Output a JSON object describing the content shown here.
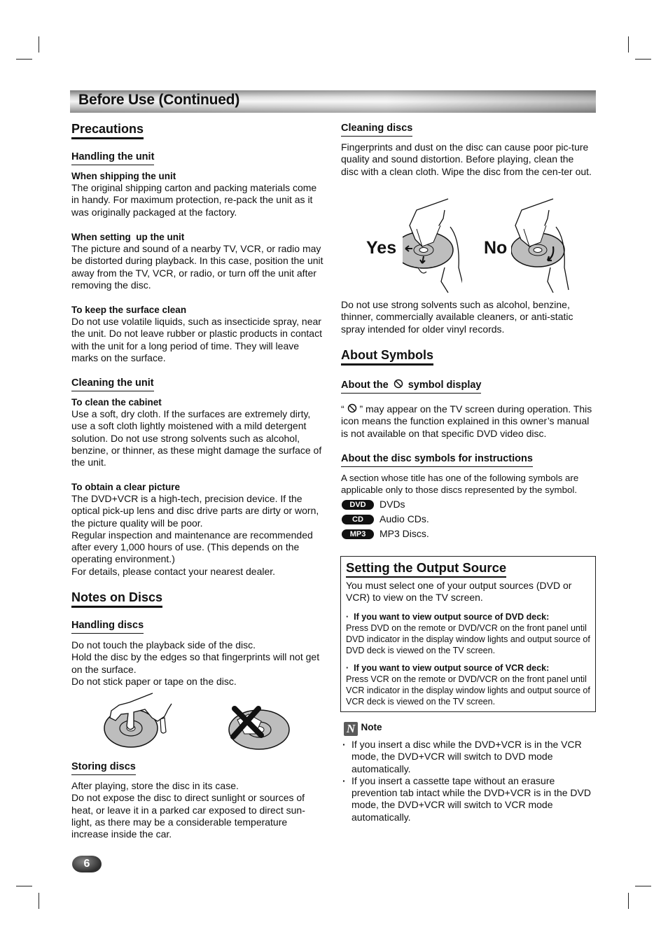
{
  "header": {
    "title": "Before Use (Continued)"
  },
  "left": {
    "precautions": {
      "title": "Precautions",
      "handling_unit": {
        "title": "Handling the unit",
        "items": [
          {
            "heading": "When shipping the unit",
            "text": "The original shipping carton and packing materials come in handy. For maximum protection, re-pack the unit as it was originally packaged at the factory."
          },
          {
            "heading": "When setting  up the unit",
            "text": "The picture and sound of a nearby TV, VCR, or radio may be distorted during playback. In this case, position the unit away from the TV, VCR, or radio, or turn off the unit after removing the disc."
          },
          {
            "heading": "To keep the surface clean",
            "text": "Do not use volatile liquids, such as insecticide spray, near the unit. Do not leave rubber or plastic products in contact with the unit for a long period of time. They will leave marks on the surface."
          }
        ]
      },
      "cleaning_unit": {
        "title": "Cleaning the unit",
        "items": [
          {
            "heading": "To clean the cabinet",
            "text": "Use a soft, dry cloth. If the surfaces are extremely dirty, use a soft cloth lightly moistened with a mild detergent solution. Do not use strong solvents such as alcohol, benzine, or thinner, as these might damage the surface of the unit."
          },
          {
            "heading": "To obtain a clear picture",
            "text": "The DVD+VCR is a high-tech, precision device. If the optical pick-up lens and disc drive parts are dirty or worn, the picture quality will be poor.",
            "text2": "Regular inspection and maintenance are recommended after every 1,000 hours of use. (This depends on the operating environment.)",
            "text3": "For details, please contact your nearest dealer."
          }
        ]
      }
    },
    "notes_on_discs": {
      "title": "Notes on Discs",
      "handling_discs": {
        "title": "Handling discs",
        "lines": [
          "Do not touch the playback side of the disc.",
          "Hold the disc by the edges so that fingerprints will not get on the surface.",
          "Do not stick paper or tape on the disc."
        ]
      },
      "storing_discs": {
        "title": "Storing discs",
        "lines": [
          "After playing, store the disc in its case.",
          "Do not expose the disc to direct sunlight or sources of heat, or leave it in a parked car exposed to direct sun-light, as there may be a considerable temperature increase inside the car."
        ]
      }
    }
  },
  "right": {
    "cleaning_discs": {
      "title": "Cleaning discs",
      "text": "Fingerprints and dust on the disc can cause poor pic-ture quality and sound distortion. Before playing, clean the disc with a clean cloth. Wipe the disc from the cen-ter out.",
      "yes_label": "Yes",
      "no_label": "No",
      "warning": "Do not use strong solvents such as alcohol, benzine, thinner, commercially available cleaners, or anti-static spray intended for older vinyl records."
    },
    "about_symbols": {
      "title": "About Symbols",
      "symbol_display": {
        "title_before": "About the",
        "title_after": "symbol display",
        "text_open": "“",
        "text_after": "” may appear on the TV screen during operation. This icon means the function explained in this owner’s manual is not available on that specific DVD video disc."
      },
      "disc_symbols": {
        "title": "About the disc symbols for instructions",
        "text": "A section whose title has one of the following symbols are applicable only to those discs represented by the symbol.",
        "items": [
          {
            "badge": "DVD",
            "label": "DVDs"
          },
          {
            "badge": "CD",
            "label": "Audio CDs."
          },
          {
            "badge": "MP3",
            "label": "MP3 Discs."
          }
        ]
      }
    },
    "output_source": {
      "title": "Setting the Output Source",
      "intro": "You must select one of your output sources (DVD or VCR) to view on the TV screen.",
      "items": [
        {
          "heading": "If you want to view output source of DVD deck:",
          "text": "Press DVD on the remote or DVD/VCR on the front panel until DVD indicator in the display window lights and output source of DVD deck is viewed on the TV screen."
        },
        {
          "heading": "If you want to view output source of VCR deck:",
          "text": "Press VCR on the remote or DVD/VCR on the front panel until VCR indicator in the display window lights and output source of VCR deck is viewed on the TV screen."
        }
      ]
    },
    "note": {
      "icon_letter": "N",
      "title": "Note",
      "items": [
        "If you insert a disc while the DVD+VCR is in the VCR mode, the DVD+VCR will switch to DVD mode automatically.",
        "If you insert a cassette tape without an erasure prevention tab intact while the DVD+VCR is in the DVD mode, the DVD+VCR will switch to VCR mode automatically."
      ]
    }
  },
  "footer": {
    "page_number": "6"
  }
}
